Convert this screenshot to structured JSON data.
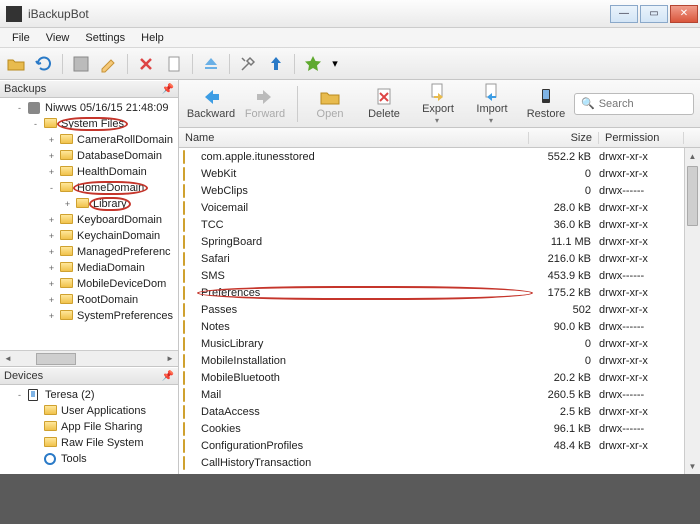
{
  "window": {
    "title": "iBackupBot"
  },
  "menu": [
    "File",
    "View",
    "Settings",
    "Help"
  ],
  "panels": {
    "backups": "Backups",
    "devices": "Devices"
  },
  "backup_root": "Niwws 05/16/15 21:48:09",
  "tree": [
    {
      "label": "System Files",
      "indent": 2,
      "exp": "-",
      "circled": true
    },
    {
      "label": "CameraRollDomain",
      "indent": 3,
      "exp": "+"
    },
    {
      "label": "DatabaseDomain",
      "indent": 3,
      "exp": "+"
    },
    {
      "label": "HealthDomain",
      "indent": 3,
      "exp": "+"
    },
    {
      "label": "HomeDomain",
      "indent": 3,
      "exp": "-",
      "circled": true
    },
    {
      "label": "Library",
      "indent": 4,
      "exp": "+",
      "circled": true
    },
    {
      "label": "KeyboardDomain",
      "indent": 3,
      "exp": "+"
    },
    {
      "label": "KeychainDomain",
      "indent": 3,
      "exp": "+"
    },
    {
      "label": "ManagedPreferenc",
      "indent": 3,
      "exp": "+"
    },
    {
      "label": "MediaDomain",
      "indent": 3,
      "exp": "+"
    },
    {
      "label": "MobileDeviceDom",
      "indent": 3,
      "exp": "+"
    },
    {
      "label": "RootDomain",
      "indent": 3,
      "exp": "+"
    },
    {
      "label": "SystemPreferences",
      "indent": 3,
      "exp": "+"
    }
  ],
  "device_root": "Teresa (2)",
  "device_items": [
    {
      "label": "User Applications",
      "kind": "folder"
    },
    {
      "label": "App File Sharing",
      "kind": "folder"
    },
    {
      "label": "Raw File System",
      "kind": "folder"
    },
    {
      "label": "Tools",
      "kind": "gear"
    }
  ],
  "toolbar2": {
    "backward": "Backward",
    "forward": "Forward",
    "open": "Open",
    "delete": "Delete",
    "export": "Export",
    "import": "Import",
    "restore": "Restore"
  },
  "search_placeholder": "Search",
  "columns": {
    "name": "Name",
    "size": "Size",
    "perm": "Permission"
  },
  "files": [
    {
      "name": "com.apple.itunesstored",
      "size": "552.2 kB",
      "perm": "drwxr-xr-x"
    },
    {
      "name": "WebKit",
      "size": "0",
      "perm": "drwxr-xr-x"
    },
    {
      "name": "WebClips",
      "size": "0",
      "perm": "drwx------"
    },
    {
      "name": "Voicemail",
      "size": "28.0 kB",
      "perm": "drwxr-xr-x"
    },
    {
      "name": "TCC",
      "size": "36.0 kB",
      "perm": "drwxr-xr-x"
    },
    {
      "name": "SpringBoard",
      "size": "11.1 MB",
      "perm": "drwxr-xr-x"
    },
    {
      "name": "Safari",
      "size": "216.0 kB",
      "perm": "drwxr-xr-x"
    },
    {
      "name": "SMS",
      "size": "453.9 kB",
      "perm": "drwx------"
    },
    {
      "name": "Preferences",
      "size": "175.2 kB",
      "perm": "drwxr-xr-x",
      "circled": true
    },
    {
      "name": "Passes",
      "size": "502",
      "perm": "drwxr-xr-x"
    },
    {
      "name": "Notes",
      "size": "90.0 kB",
      "perm": "drwx------"
    },
    {
      "name": "MusicLibrary",
      "size": "0",
      "perm": "drwxr-xr-x"
    },
    {
      "name": "MobileInstallation",
      "size": "0",
      "perm": "drwxr-xr-x"
    },
    {
      "name": "MobileBluetooth",
      "size": "20.2 kB",
      "perm": "drwxr-xr-x"
    },
    {
      "name": "Mail",
      "size": "260.5 kB",
      "perm": "drwx------"
    },
    {
      "name": "DataAccess",
      "size": "2.5 kB",
      "perm": "drwxr-xr-x"
    },
    {
      "name": "Cookies",
      "size": "96.1 kB",
      "perm": "drwx------"
    },
    {
      "name": "ConfigurationProfiles",
      "size": "48.4 kB",
      "perm": "drwxr-xr-x"
    },
    {
      "name": "CallHistoryTransaction",
      "size": "",
      "perm": ""
    }
  ]
}
